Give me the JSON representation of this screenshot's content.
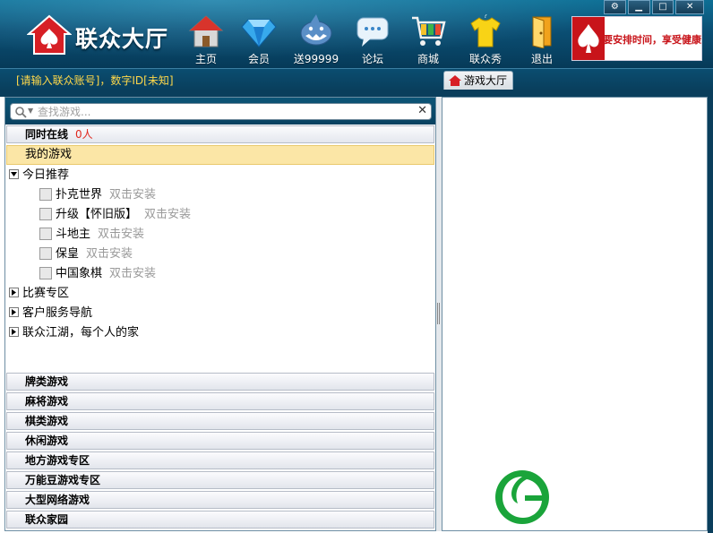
{
  "header": {
    "logo_text": "联众大厅",
    "nav": [
      {
        "label": "主页",
        "icon": "home-icon"
      },
      {
        "label": "会员",
        "icon": "diamond-icon"
      },
      {
        "label": "送99999",
        "icon": "shark-icon"
      },
      {
        "label": "论坛",
        "icon": "chat-bubble-icon"
      },
      {
        "label": "商城",
        "icon": "shopping-cart-icon"
      },
      {
        "label": "联众秀",
        "icon": "tshirt-icon"
      },
      {
        "label": "退出",
        "icon": "exit-door-icon"
      }
    ],
    "ad_text": "要安排时间，享受健康生活",
    "window_controls": [
      "settings-icon",
      "minimize-icon",
      "maximize-icon",
      "close-icon"
    ]
  },
  "status": {
    "account_text": "[请输入联众账号]，数字ID[未知]",
    "tab_label": "游戏大厅"
  },
  "search": {
    "placeholder": "查找游戏..."
  },
  "online": {
    "label": "同时在线",
    "count": "0人"
  },
  "my_games": "我的游戏",
  "today": {
    "label": "今日推荐",
    "games": [
      {
        "name": "扑克世界",
        "hint": "双击安装"
      },
      {
        "name": "升级【怀旧版】",
        "hint": "双击安装"
      },
      {
        "name": "斗地主",
        "hint": "双击安装"
      },
      {
        "name": "保皇",
        "hint": "双击安装"
      },
      {
        "name": "中国象棋",
        "hint": "双击安装"
      }
    ]
  },
  "tree_nodes": [
    "比赛专区",
    "客户服务导航",
    "联众江湖，每个人的家"
  ],
  "categories": [
    "牌类游戏",
    "麻将游戏",
    "棋类游戏",
    "休闲游戏",
    "地方游戏专区",
    "万能豆游戏专区",
    "大型网络游戏",
    "联众家园"
  ],
  "colors": {
    "header_top": "#0d6f95",
    "header_bottom": "#063a58",
    "account_text": "#ffd84a",
    "online_count": "#e0281e",
    "my_games_bg": "#fbe6a6",
    "watermark_green": "#1aa43a"
  }
}
